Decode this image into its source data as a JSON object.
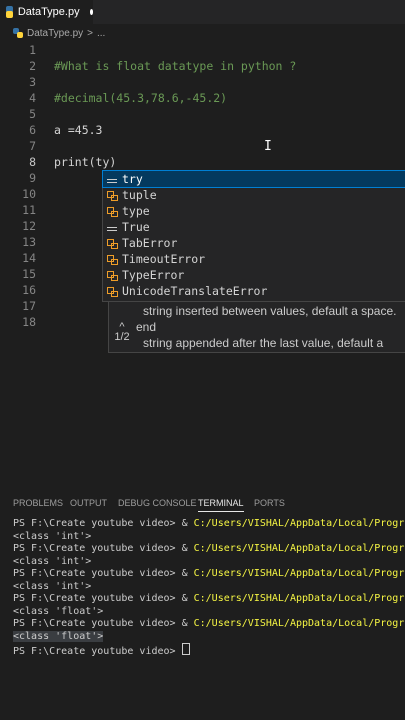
{
  "tab": {
    "filename": "DataType.py"
  },
  "breadcrumb": {
    "file": "DataType.py",
    "sep": ">",
    "rest": "..."
  },
  "editor": {
    "lines": [
      {
        "num": "1",
        "text": ""
      },
      {
        "num": "2",
        "text": "#What is float datatype in python ?"
      },
      {
        "num": "3",
        "text": ""
      },
      {
        "num": "4",
        "text": "#decimal(45.3,78.6,-45.2)"
      },
      {
        "num": "5",
        "text": ""
      },
      {
        "num": "6",
        "text": "a =45.3"
      },
      {
        "num": "7",
        "text": ""
      },
      {
        "num": "8",
        "text": "print(ty)"
      },
      {
        "num": "9",
        "text": ""
      },
      {
        "num": "10",
        "text": ""
      },
      {
        "num": "11",
        "text": ""
      },
      {
        "num": "12",
        "text": ""
      },
      {
        "num": "13",
        "text": ""
      },
      {
        "num": "14",
        "text": ""
      },
      {
        "num": "15",
        "text": ""
      },
      {
        "num": "16",
        "text": ""
      },
      {
        "num": "17",
        "text": ""
      },
      {
        "num": "18",
        "text": ""
      }
    ]
  },
  "suggest": {
    "items": [
      {
        "label": "try",
        "icon": "keyword-icon"
      },
      {
        "label": "tuple",
        "icon": "class-icon"
      },
      {
        "label": "type",
        "icon": "class-icon"
      },
      {
        "label": "True",
        "icon": "keyword-icon"
      },
      {
        "label": "TabError",
        "icon": "class-icon"
      },
      {
        "label": "TimeoutError",
        "icon": "class-icon"
      },
      {
        "label": "TypeError",
        "icon": "class-icon"
      },
      {
        "label": "UnicodeTranslateError",
        "icon": "class-icon"
      }
    ]
  },
  "signature": {
    "counter": "1/2",
    "line1": "string inserted between values, default a space.",
    "line2": "end",
    "line3": "string appended after the last value, default a"
  },
  "panel": {
    "tabs": [
      "PROBLEMS",
      "OUTPUT",
      "DEBUG CONSOLE",
      "TERMINAL",
      "PORTS"
    ],
    "active": "TERMINAL"
  },
  "terminal": {
    "prompt": "PS F:\\Create youtube video> ",
    "cmd_prefix": "& ",
    "cmd_path": "C:/Users/VISHAL/AppData/Local/Programs/Python/",
    "outputs": [
      "<class 'int'>",
      "<class 'int'>",
      "<class 'int'>",
      "<class 'float'>",
      "<class 'float'>"
    ]
  }
}
